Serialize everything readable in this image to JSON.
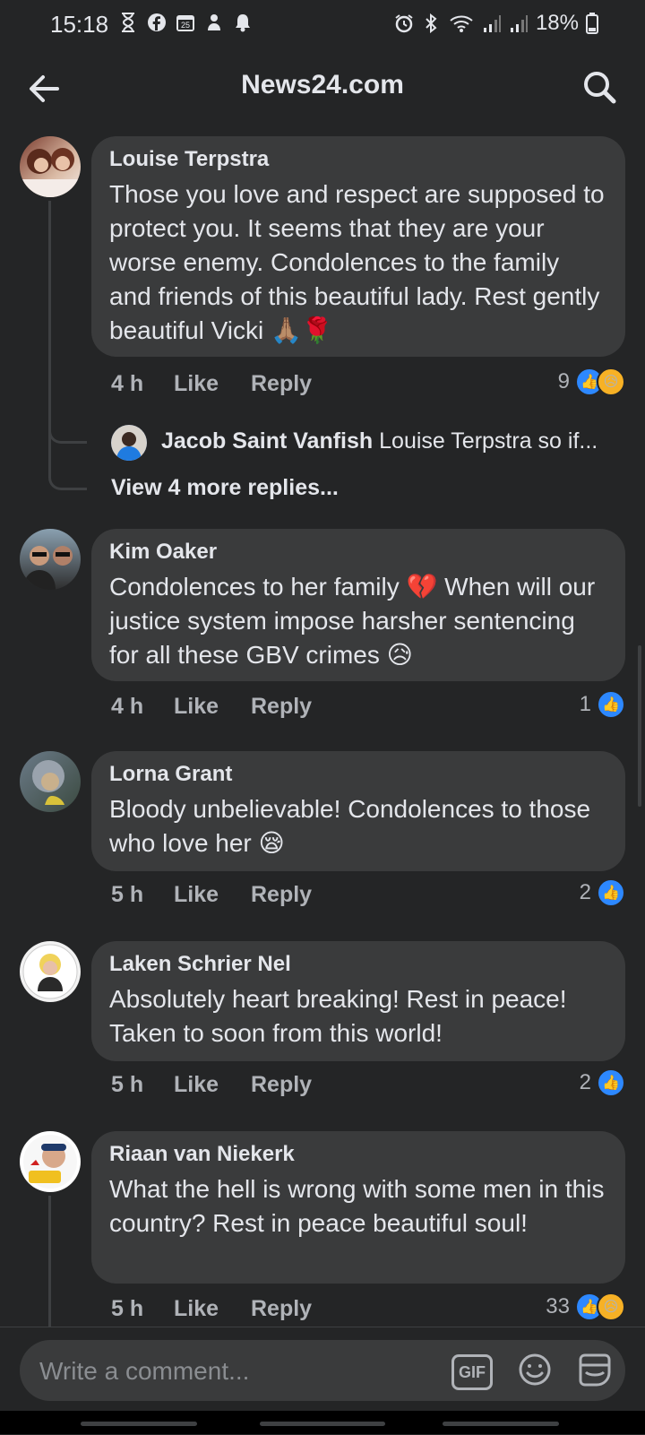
{
  "status": {
    "time": "15:18",
    "battery": "18%",
    "left_icons": [
      "hourglass-icon",
      "facebook-icon",
      "calendar-icon",
      "app-icon",
      "bell-icon"
    ],
    "calendar_day": "25"
  },
  "header": {
    "title": "News24.com"
  },
  "comments": [
    {
      "author": "Louise Terpstra",
      "text": "Those you love and respect are supposed to protect you. It seems that they are your worse enemy. Condolences to the family and friends of this beautiful lady. Rest gently beautiful Vicki 🙏🏽🌹",
      "time": "4 h",
      "like": "Like",
      "reply": "Reply",
      "reactions": "9",
      "reply_preview": {
        "author": "Jacob Saint Vanfish",
        "text": "Louise Terpstra so if..."
      },
      "view_more": "View 4 more replies..."
    },
    {
      "author": "Kim Oaker",
      "text": "Condolences to her family 💔 When will our justice system impose harsher sentencing for all these GBV crimes 😥",
      "time": "4 h",
      "like": "Like",
      "reply": "Reply",
      "reactions": "1"
    },
    {
      "author": "Lorna Grant",
      "text": "Bloody unbelievable! Condolences to those who love her 😪",
      "time": "5 h",
      "like": "Like",
      "reply": "Reply",
      "reactions": "2"
    },
    {
      "author": "Laken Schrier Nel",
      "text": "Absolutely heart breaking! Rest in peace! Taken to soon from this world!",
      "time": "5 h",
      "like": "Like",
      "reply": "Reply",
      "reactions": "2"
    },
    {
      "author": "Riaan van Niekerk",
      "text": "What the hell is wrong with some  men in this country? Rest in peace beautiful soul!",
      "time": "5 h",
      "like": "Like",
      "reply": "Reply",
      "reactions": "33"
    }
  ],
  "composer": {
    "placeholder": "Write a comment...",
    "gif_label": "GIF"
  },
  "colors": {
    "background": "#242526",
    "bubble": "#3a3b3c",
    "like_blue": "#2d88ff",
    "sad_yellow": "#f7b125"
  }
}
